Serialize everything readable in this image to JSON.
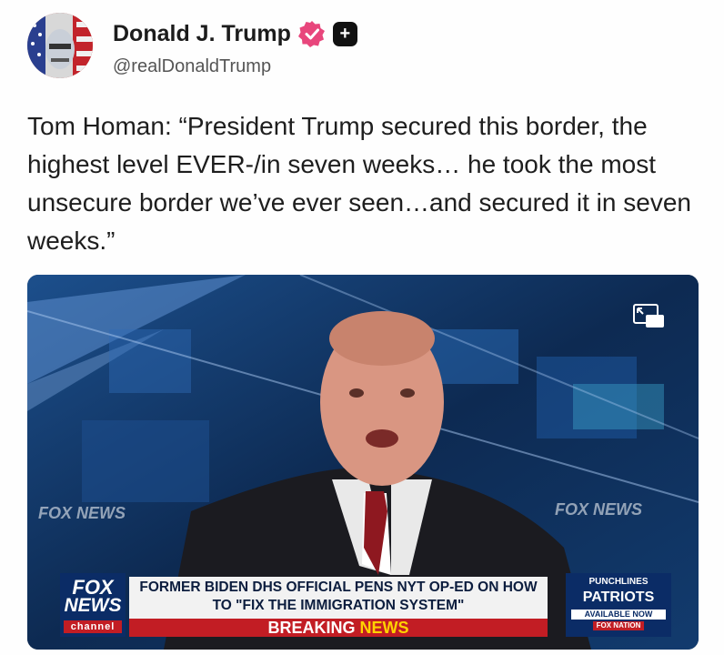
{
  "author": {
    "name": "Donald J. Trump",
    "handle": "@realDonaldTrump"
  },
  "post": {
    "text": "Tom Homan: “President Trump secured this border, the highest level EVER-/in seven weeks… he took the most unsecure border we’ve ever seen…and secured it in seven weeks.”"
  },
  "video": {
    "watermark_left": "FOX NEWS",
    "watermark_right": "FOX NEWS",
    "network_logo": {
      "line1": "FOX",
      "line2": "NEWS",
      "line3": "channel"
    },
    "headline": "FORMER BIDEN DHS OFFICIAL PENS NYT OP-ED ON HOW TO \"FIX THE IMMIGRATION SYSTEM\"",
    "breaking_word": "BREAKING",
    "news_word": "NEWS",
    "promo": {
      "line1": "PUNCHLINES",
      "line2": "PATRIOTS",
      "line3": "AVAILABLE NOW",
      "line4": "FOX NATION"
    }
  },
  "colors": {
    "verified_badge": "#e8467c",
    "fox_blue": "#0b2c66",
    "breaking_red": "#c21d24"
  },
  "icons": [
    "verified-badge-icon",
    "plus-badge-icon",
    "picture-in-picture-icon"
  ]
}
